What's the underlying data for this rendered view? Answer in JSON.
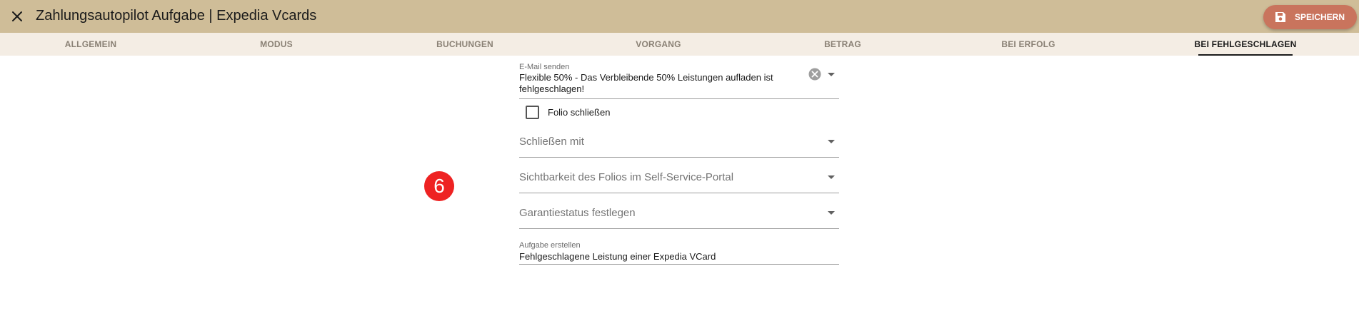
{
  "header": {
    "title": "Zahlungsautopilot Aufgabe | Expedia Vcards",
    "close_icon": "close-icon",
    "save_label": "SPEICHERN",
    "save_icon": "save-icon",
    "background_color": "#cfbd98",
    "save_color": "#c9745d"
  },
  "tabs": [
    {
      "label": "ALLGEMEIN",
      "active": false
    },
    {
      "label": "MODUS",
      "active": false
    },
    {
      "label": "BUCHUNGEN",
      "active": false
    },
    {
      "label": "VORGANG",
      "active": false
    },
    {
      "label": "BETRAG",
      "active": false
    },
    {
      "label": "BEI ERFOLG",
      "active": false
    },
    {
      "label": "BEI FEHLGESCHLAGEN",
      "active": true
    }
  ],
  "form": {
    "email": {
      "label": "E-Mail senden",
      "value_line1": "Flexible 50% - Das Verbleibende 50% Leistungen aufladen ist",
      "value_line2": "fehlgeschlagen!"
    },
    "close_folio": {
      "label": "Folio schließen",
      "checked": false
    },
    "close_with": {
      "placeholder": "Schließen mit"
    },
    "visibility": {
      "placeholder": "Sichtbarkeit des Folios im Self-Service-Portal"
    },
    "guarantee": {
      "placeholder": "Garantiestatus festlegen"
    },
    "create_task": {
      "label": "Aufgabe erstellen",
      "value": "Fehlgeschlagene Leistung einer Expedia VCard"
    }
  },
  "step_badge": {
    "number": "6",
    "color": "#ee2222"
  }
}
